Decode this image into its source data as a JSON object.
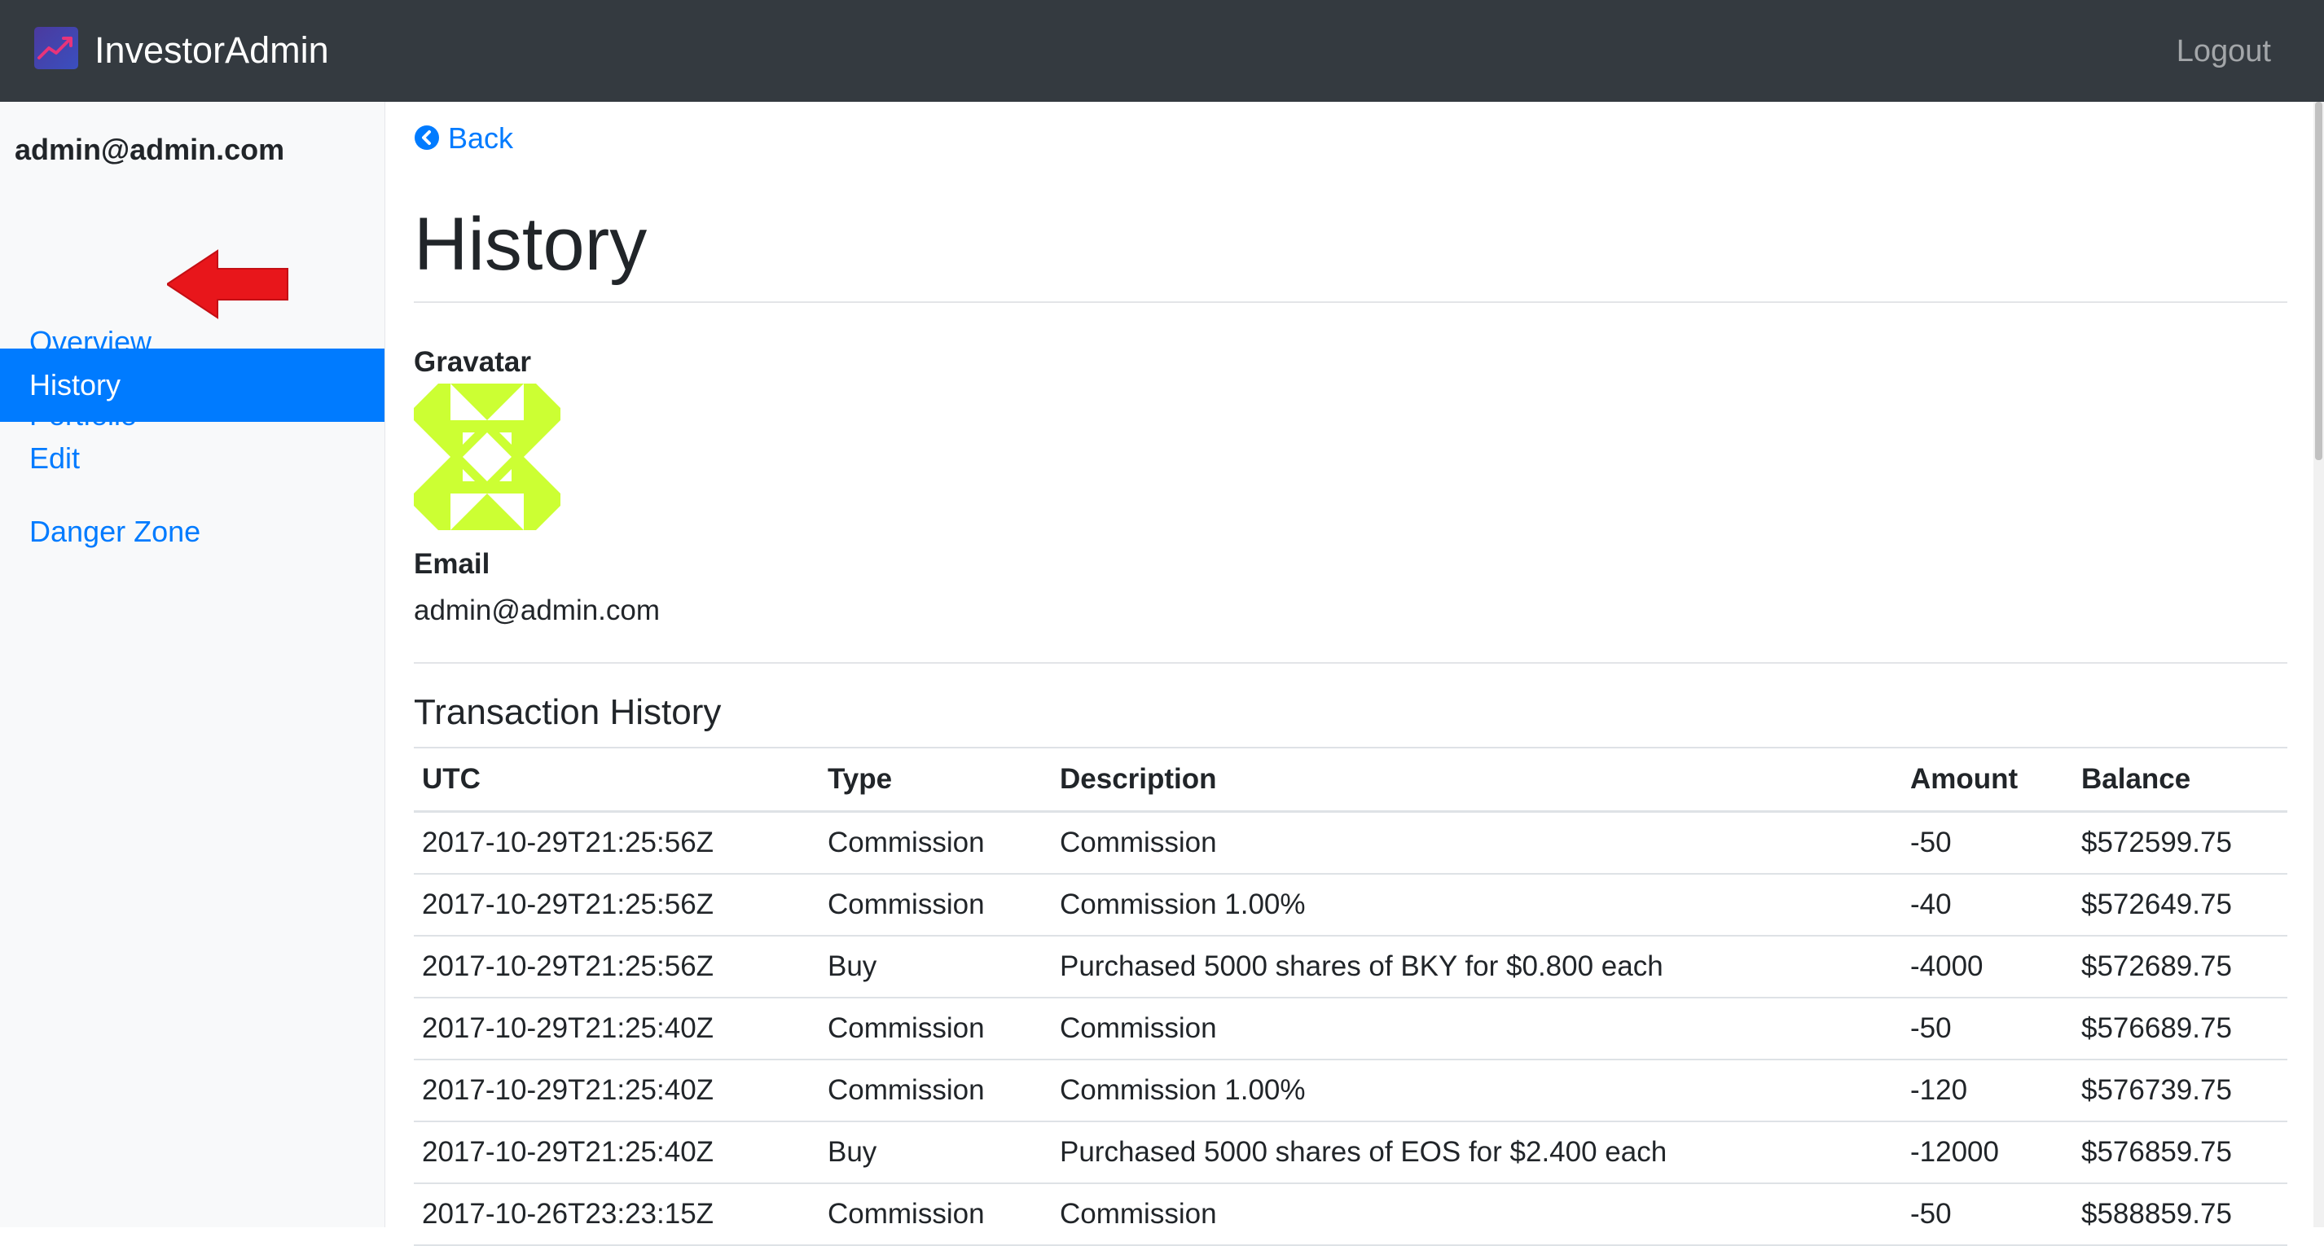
{
  "header": {
    "brand": "InvestorAdmin",
    "logout_label": "Logout",
    "logo_icon": "trending-up-icon",
    "colors": {
      "navbar": "#343a40",
      "accent": "#007bff"
    }
  },
  "sidebar": {
    "user_email": "admin@admin.com",
    "items": [
      {
        "label": "Overview",
        "active": false
      },
      {
        "label": "Portfolio",
        "active": false
      },
      {
        "label": "History",
        "active": true
      },
      {
        "label": "Edit",
        "active": false
      },
      {
        "label": "Danger Zone",
        "active": false
      }
    ],
    "annotation": "red-arrow-pointing-left"
  },
  "main": {
    "back_label": "Back",
    "back_icon": "chevron-circle-left-icon",
    "title": "History",
    "gravatar_label": "Gravatar",
    "gravatar_color": "#ccff33",
    "email_label": "Email",
    "email_value": "admin@admin.com",
    "transactions": {
      "title": "Transaction History",
      "columns": [
        "UTC",
        "Type",
        "Description",
        "Amount",
        "Balance"
      ],
      "rows": [
        [
          "2017-10-29T21:25:56Z",
          "Commission",
          "Commission",
          "-50",
          "$572599.75"
        ],
        [
          "2017-10-29T21:25:56Z",
          "Commission",
          "Commission 1.00%",
          "-40",
          "$572649.75"
        ],
        [
          "2017-10-29T21:25:56Z",
          "Buy",
          "Purchased 5000 shares of BKY for $0.800 each",
          "-4000",
          "$572689.75"
        ],
        [
          "2017-10-29T21:25:40Z",
          "Commission",
          "Commission",
          "-50",
          "$576689.75"
        ],
        [
          "2017-10-29T21:25:40Z",
          "Commission",
          "Commission 1.00%",
          "-120",
          "$576739.75"
        ],
        [
          "2017-10-29T21:25:40Z",
          "Buy",
          "Purchased 5000 shares of EOS for $2.400 each",
          "-12000",
          "$576859.75"
        ],
        [
          "2017-10-26T23:23:15Z",
          "Commission",
          "Commission",
          "-50",
          "$588859.75"
        ]
      ]
    }
  }
}
